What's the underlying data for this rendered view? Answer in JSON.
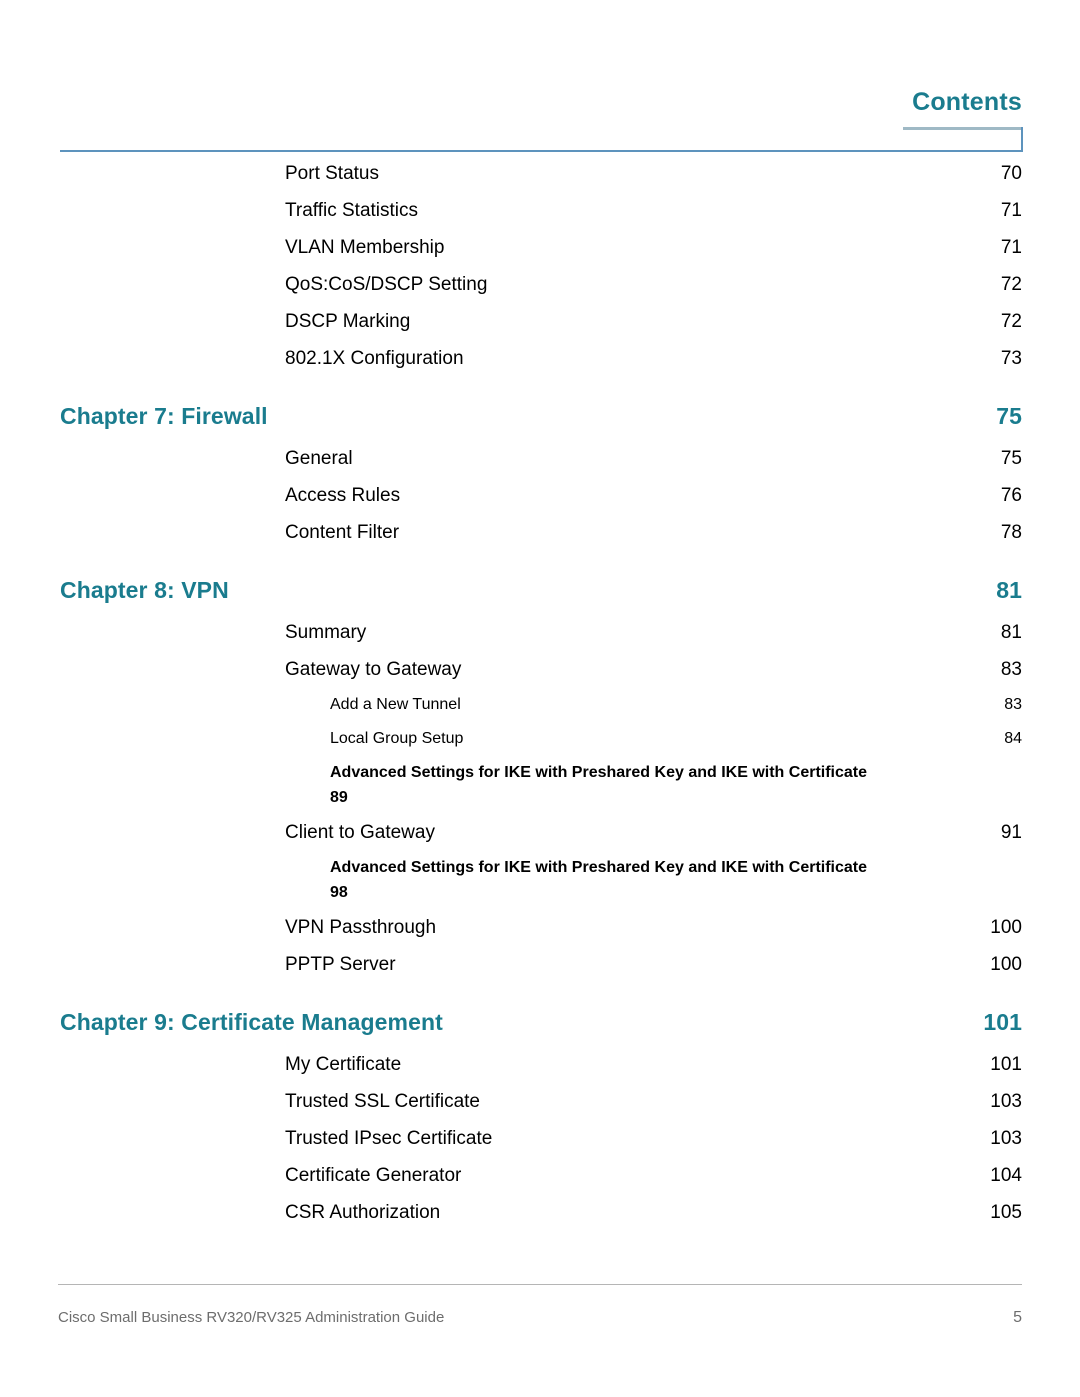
{
  "header": {
    "title": "Contents"
  },
  "toc": {
    "entries": [
      {
        "level": 1,
        "label": "Port Status",
        "page": "70"
      },
      {
        "level": 1,
        "label": "Traffic Statistics",
        "page": "71"
      },
      {
        "level": 1,
        "label": "VLAN Membership",
        "page": "71"
      },
      {
        "level": 1,
        "label": "QoS:CoS/DSCP Setting",
        "page": "72"
      },
      {
        "level": 1,
        "label": "DSCP Marking",
        "page": "72"
      },
      {
        "level": 1,
        "label": "802.1X Configuration",
        "page": "73"
      },
      {
        "level": 0,
        "label": "Chapter 7: Firewall",
        "page": "75"
      },
      {
        "level": 1,
        "label": "General",
        "page": "75"
      },
      {
        "level": 1,
        "label": "Access Rules",
        "page": "76"
      },
      {
        "level": 1,
        "label": "Content Filter",
        "page": "78"
      },
      {
        "level": 0,
        "label": "Chapter 8: VPN",
        "page": "81"
      },
      {
        "level": 1,
        "label": "Summary",
        "page": "81"
      },
      {
        "level": 1,
        "label": "Gateway to Gateway",
        "page": "83"
      },
      {
        "level": 2,
        "label": "Add a New Tunnel",
        "page": "83"
      },
      {
        "level": 2,
        "label": "Local Group Setup",
        "page": "84"
      },
      {
        "level": 2,
        "wrap": true,
        "label": "Advanced Settings for IKE with Preshared Key and IKE with Certificate",
        "page": "89"
      },
      {
        "level": 1,
        "label": "Client to Gateway",
        "page": "91"
      },
      {
        "level": 2,
        "wrap": true,
        "label": "Advanced Settings for IKE with Preshared Key and IKE with Certificate",
        "page": "98"
      },
      {
        "level": 1,
        "label": "VPN Passthrough",
        "page": "100"
      },
      {
        "level": 1,
        "label": "PPTP Server",
        "page": "100"
      },
      {
        "level": 0,
        "label": "Chapter 9: Certificate Management",
        "page": "101"
      },
      {
        "level": 1,
        "label": "My Certificate",
        "page": "101"
      },
      {
        "level": 1,
        "label": "Trusted SSL Certificate",
        "page": "103"
      },
      {
        "level": 1,
        "label": "Trusted IPsec Certificate",
        "page": "103"
      },
      {
        "level": 1,
        "label": "Certificate Generator",
        "page": "104"
      },
      {
        "level": 1,
        "label": "CSR Authorization",
        "page": "105"
      }
    ]
  },
  "footer": {
    "text": "Cisco Small Business RV320/RV325  Administration Guide",
    "page": "5"
  },
  "colors": {
    "heading_teal": "#1a7c8e",
    "rule_blue": "#5d93bd",
    "tab_gray": "#9fb9c5",
    "footer_gray": "#6d6d6d"
  }
}
